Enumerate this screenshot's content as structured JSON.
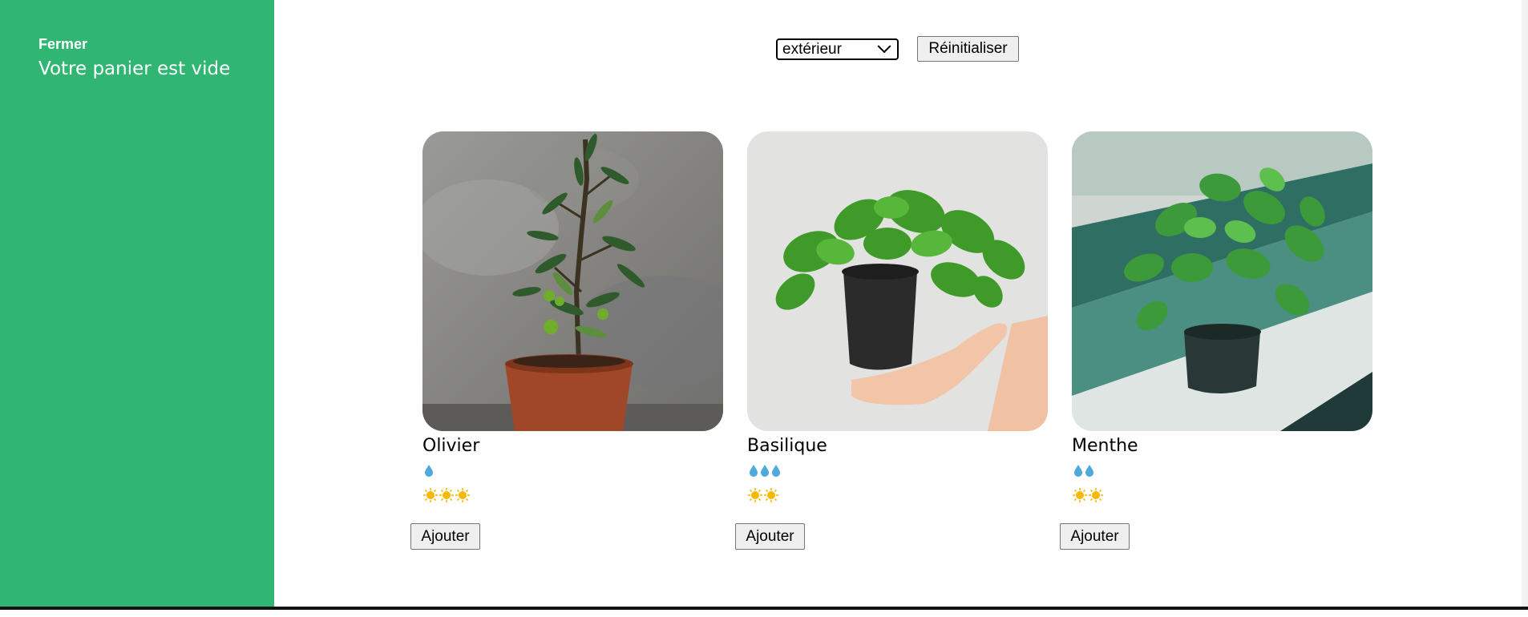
{
  "sidebar": {
    "close_label": "Fermer",
    "cart_message": "Votre panier est vide",
    "background_color": "#31b572"
  },
  "filters": {
    "selected_category": "extérieur",
    "reset_label": "Réinitialiser"
  },
  "plants": [
    {
      "name": "Olivier",
      "water": 1,
      "light": 3,
      "image_icon": "olive-tree-photo",
      "add_label": "Ajouter"
    },
    {
      "name": "Basilique",
      "water": 3,
      "light": 2,
      "image_icon": "basil-plant-photo",
      "add_label": "Ajouter"
    },
    {
      "name": "Menthe",
      "water": 2,
      "light": 2,
      "image_icon": "mint-plant-photo",
      "add_label": "Ajouter"
    }
  ],
  "icons": {
    "water": "water-drop-icon",
    "light": "sun-icon"
  },
  "colors": {
    "water_drop": "#4ea9dd",
    "sun": "#f9b800"
  }
}
